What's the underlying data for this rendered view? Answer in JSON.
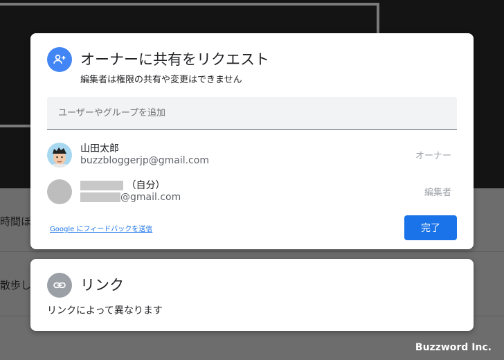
{
  "background": {
    "text_line_1": "時間ほ",
    "text_line_2": "散歩し"
  },
  "share_dialog": {
    "title": "オーナーに共有をリクエスト",
    "subtitle": "編集者は権限の共有や変更はできません",
    "search": {
      "placeholder": "ユーザーやグループを追加",
      "value": ""
    },
    "people": [
      {
        "name": "山田太郎",
        "email": "buzzbloggerjp@gmail.com",
        "role": "オーナー"
      },
      {
        "name_suffix": "（自分）",
        "email_domain": "@gmail.com",
        "role": "編集者"
      }
    ],
    "feedback_link": "Google にフィードバックを送信",
    "done_button": "完了",
    "accent_color": "#1a73e8",
    "badge_color": "#4285f4"
  },
  "link_section": {
    "title": "リンク",
    "description": "リンクによって異なります"
  },
  "watermark": "Buzzword Inc.",
  "icons": {
    "add_person": "person-add-icon",
    "link": "link-icon"
  }
}
